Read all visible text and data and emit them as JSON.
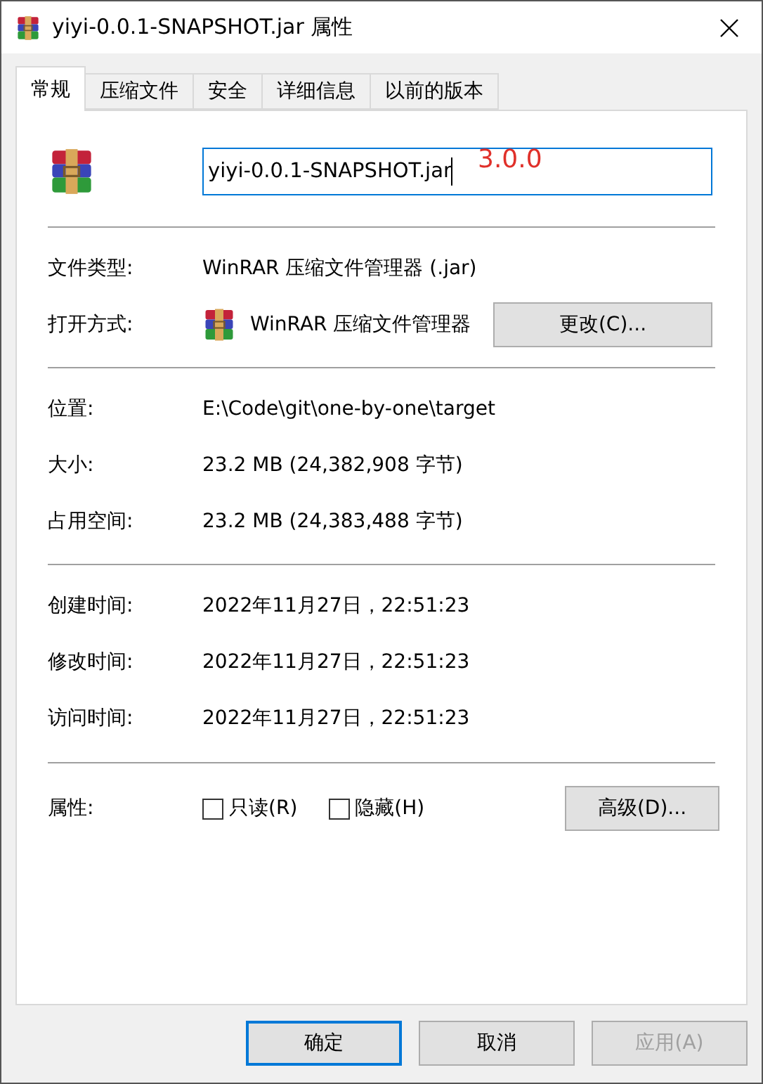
{
  "window": {
    "title": "yiyi-0.0.1-SNAPSHOT.jar 属性"
  },
  "tabs": [
    {
      "label": "常规",
      "selected": true
    },
    {
      "label": "压缩文件",
      "selected": false
    },
    {
      "label": "安全",
      "selected": false
    },
    {
      "label": "详细信息",
      "selected": false
    },
    {
      "label": "以前的版本",
      "selected": false
    }
  ],
  "file_name": {
    "value": "yiyi-0.0.1-SNAPSHOT.jar",
    "annotation": "3.0.0"
  },
  "type_section": [
    {
      "label": "文件类型:",
      "value": "WinRAR 压缩文件管理器 (.jar)"
    },
    {
      "label": "打开方式:",
      "value": "WinRAR 压缩文件管理器",
      "button": "更改(C)..."
    }
  ],
  "location_section": [
    {
      "label": "位置:",
      "value": "E:\\Code\\git\\one-by-one\\target"
    },
    {
      "label": "大小:",
      "value": "23.2 MB (24,382,908 字节)"
    },
    {
      "label": "占用空间:",
      "value": "23.2 MB (24,383,488 字节)"
    }
  ],
  "time_section": [
    {
      "label": "创建时间:",
      "value": "2022年11月27日，22:51:23"
    },
    {
      "label": "修改时间:",
      "value": "2022年11月27日，22:51:23"
    },
    {
      "label": "访问时间:",
      "value": "2022年11月27日，22:51:23"
    }
  ],
  "attributes": {
    "label": "属性:",
    "options": [
      {
        "label": "只读(R)",
        "checked": false
      },
      {
        "label": "隐藏(H)",
        "checked": false
      }
    ],
    "button": "高级(D)..."
  },
  "buttons": [
    {
      "label": "确定",
      "disabled": false,
      "default": true
    },
    {
      "label": "取消",
      "disabled": false,
      "default": false
    },
    {
      "label": "应用(A)",
      "disabled": true,
      "default": false
    }
  ]
}
